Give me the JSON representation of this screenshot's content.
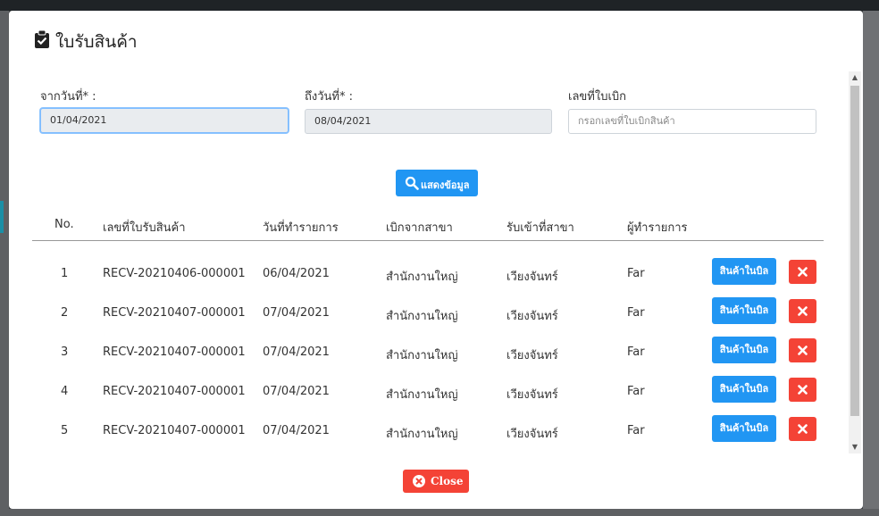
{
  "modal": {
    "title": "ใบรับสินค้า",
    "title_icon": "clipboard-check-icon"
  },
  "filters": {
    "from_date_label": "จากวันที่* :",
    "from_date_value": "01/04/2021",
    "to_date_label": "ถึงวันที่* :",
    "to_date_value": "08/04/2021",
    "voucher_label": "เลขที่ใบเบิก",
    "voucher_placeholder": "กรอกเลขที่ใบเบิกสินค้า",
    "search_label": "แสดงข้อมูล",
    "search_icon": "search-icon"
  },
  "table": {
    "columns": [
      "No.",
      "เลขที่ใบรับสินค้า",
      "วันที่ทำรายการ",
      "เบิกจากสาขา",
      "รับเข้าที่สาขา",
      "ผู้ทำรายการ"
    ],
    "rows": [
      {
        "no": "1",
        "receipt_no": "RECV-20210406-000001",
        "date": "06/04/2021",
        "from_branch": "สำนักงานใหญ่",
        "to_branch": "เวียงจันทร์",
        "by": "Far",
        "action_label": "สินค้าในบิล"
      },
      {
        "no": "2",
        "receipt_no": "RECV-20210407-000001",
        "date": "07/04/2021",
        "from_branch": "สำนักงานใหญ่",
        "to_branch": "เวียงจันทร์",
        "by": "Far",
        "action_label": "สินค้าในบิล"
      },
      {
        "no": "3",
        "receipt_no": "RECV-20210407-000001",
        "date": "07/04/2021",
        "from_branch": "สำนักงานใหญ่",
        "to_branch": "เวียงจันทร์",
        "by": "Far",
        "action_label": "สินค้าในบิล"
      },
      {
        "no": "4",
        "receipt_no": "RECV-20210407-000001",
        "date": "07/04/2021",
        "from_branch": "สำนักงานใหญ่",
        "to_branch": "เวียงจันทร์",
        "by": "Far",
        "action_label": "สินค้าในบิล"
      },
      {
        "no": "5",
        "receipt_no": "RECV-20210407-000001",
        "date": "07/04/2021",
        "from_branch": "สำนักงานใหญ่",
        "to_branch": "เวียงจันทร์",
        "by": "Far",
        "action_label": "สินค้าในบิล"
      }
    ]
  },
  "footer": {
    "close_label": "Close",
    "close_icon": "times-circle-icon"
  },
  "colors": {
    "primary": "#2196f3",
    "danger": "#f44336",
    "readonly_bg": "#e9ecef"
  }
}
